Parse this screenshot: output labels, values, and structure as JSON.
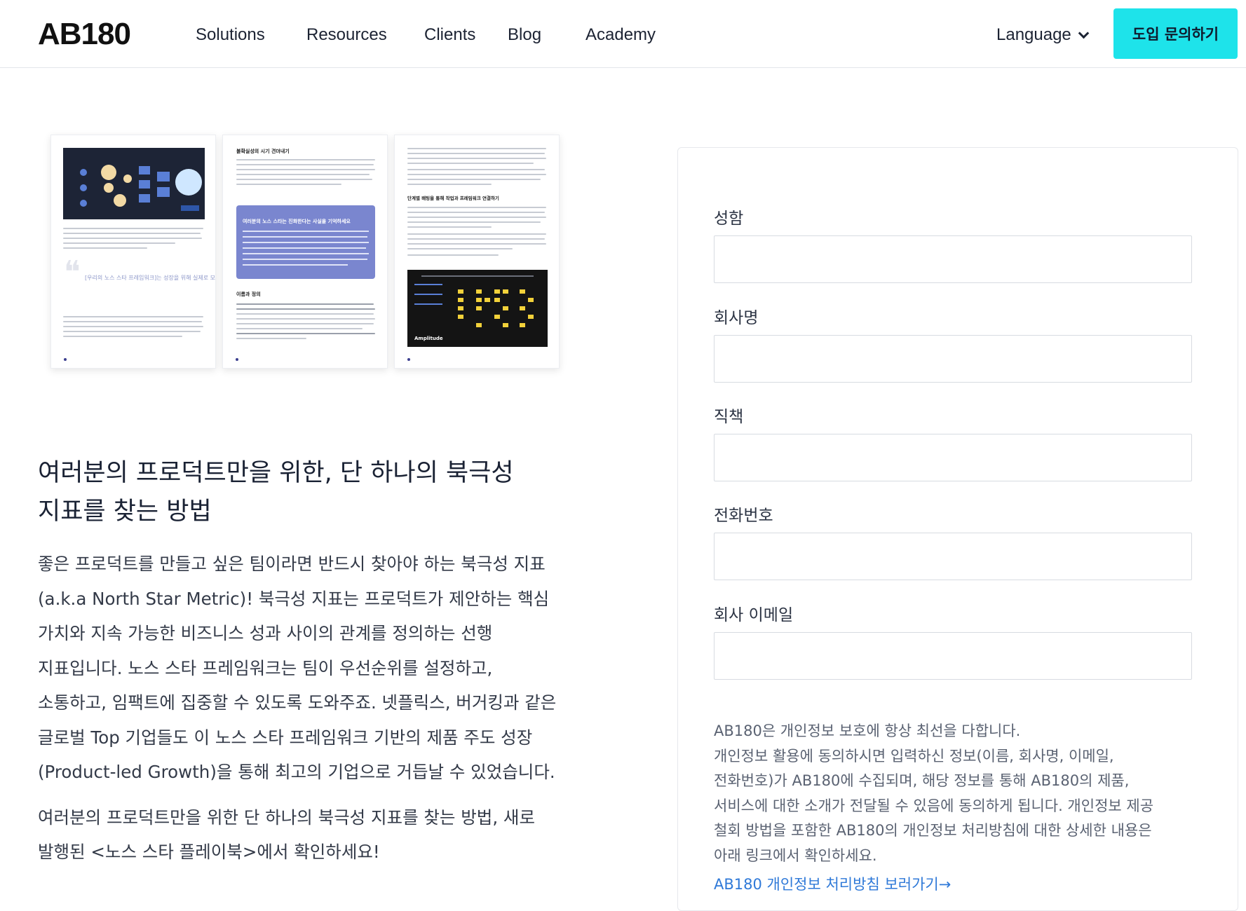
{
  "header": {
    "logo": "AB180",
    "nav": [
      "Solutions",
      "Resources",
      "Clients",
      "Blog",
      "Academy"
    ],
    "language_label": "Language",
    "cta_label": "도입 문의하기"
  },
  "preview_pages": {
    "page2_heading": "불확실성의 시기 견뎌내기",
    "page2_tip_title": "여러분의 노스 스타는 진화한다는 사실을 기억하세요",
    "page2_section": "이름과 정의",
    "page1_quote": "[우리의 노스 스타 프레임워크]는 성장을 위해 실제로 모든 팀이 사용하는 것이다.",
    "page3_heading": "단계별 배팅을 통해 작업과 프레임워크 연결하기",
    "page3_brand": "Amplitude"
  },
  "main": {
    "headline_line1": "여러분의 프로덕트만을 위한, 단 하나의 북극성",
    "headline_line2": "지표를 찾는 방법",
    "body_lines": [
      "좋은 프로덕트를 만들고 싶은 팀이라면 반드시 찾아야 하는 북극성 지표",
      "(a.k.a North Star Metric)! 북극성 지표는 프로덕트가 제안하는 핵심",
      "가치와 지속 가능한 비즈니스 성과 사이의 관계를 정의하는 선행",
      "지표입니다. 노스 스타 프레임워크는 팀이 우선순위를 설정하고,",
      "소통하고, 임팩트에 집중할 수 있도록 도와주죠. 넷플릭스, 버거킹과 같은",
      "글로벌 Top 기업들도 이 노스 스타 프레임워크 기반의 제품 주도 성장",
      "(Product-led Growth)을 통해 최고의 기업으로 거듭날 수 있었습니다."
    ],
    "closing_lines": [
      "여러분의 프로덕트만을 위한 단 하나의 북극성 지표를 찾는 방법, 새로",
      "발행된 <노스 스타 플레이북>에서 확인하세요!"
    ]
  },
  "form": {
    "fields": [
      {
        "label": "성함",
        "value": ""
      },
      {
        "label": "회사명",
        "value": ""
      },
      {
        "label": "직책",
        "value": ""
      },
      {
        "label": "전화번호",
        "value": ""
      },
      {
        "label": "회사 이메일",
        "value": ""
      }
    ],
    "privacy_lines": [
      "AB180은 개인정보 보호에 항상 최선을 다합니다.",
      "개인정보 활용에 동의하시면 입력하신 정보(이름, 회사명, 이메일,",
      "전화번호)가 AB180에 수집되며, 해당 정보를 통해 AB180의 제품,",
      "서비스에 대한 소개가 전달될 수 있음에 동의하게 됩니다. 개인정보 제공",
      "철회 방법을 포함한 AB180의 개인정보 처리방침에 대한 상세한 내용은",
      "아래 링크에서 확인하세요."
    ],
    "privacy_link": "AB180 개인정보 처리방침 보러가기→"
  },
  "colors": {
    "cta_bg": "#1ee3ea",
    "link": "#2f79d8",
    "tip_box": "#7a86cf"
  }
}
